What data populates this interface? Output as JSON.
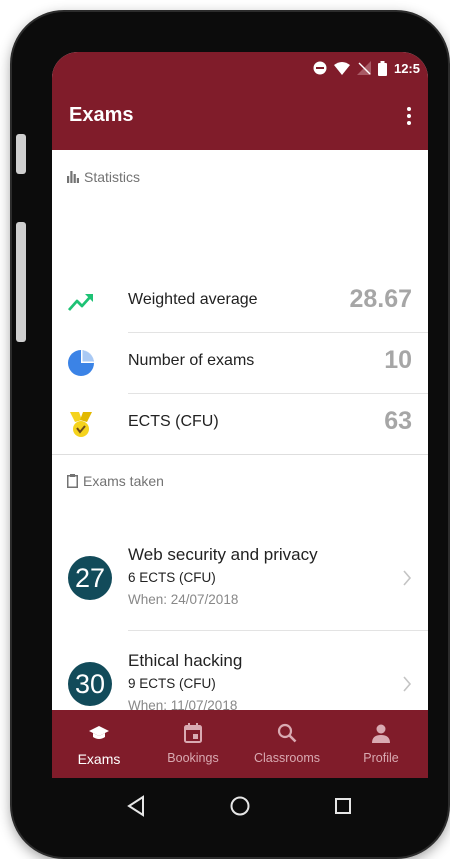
{
  "status_bar": {
    "time": "12:5"
  },
  "app_bar": {
    "title": "Exams"
  },
  "statistics": {
    "header": "Statistics",
    "items": [
      {
        "label": "Weighted average",
        "value": "28.67",
        "icon": "trending-up-icon"
      },
      {
        "label": "Number of exams",
        "value": "10",
        "icon": "pie-chart-icon"
      },
      {
        "label": "ECTS (CFU)",
        "value": "63",
        "icon": "medal-icon"
      }
    ]
  },
  "exams_taken": {
    "header": "Exams taken",
    "items": [
      {
        "grade": "27",
        "name": "Web security and privacy",
        "credits": "6 ECTS (CFU)",
        "when": "When: 24/07/2018"
      },
      {
        "grade": "30",
        "name": "Ethical hacking",
        "credits": "9 ECTS (CFU)",
        "when": "When: 11/07/2018"
      }
    ]
  },
  "bottom_nav": [
    {
      "label": "Exams",
      "icon": "graduation-cap-icon",
      "active": true
    },
    {
      "label": "Bookings",
      "icon": "calendar-icon",
      "active": false
    },
    {
      "label": "Classrooms",
      "icon": "search-icon",
      "active": false
    },
    {
      "label": "Profile",
      "icon": "person-icon",
      "active": false
    }
  ],
  "colors": {
    "primary": "#801c2a",
    "grade_badge": "#124b5a",
    "trend_green": "#1ec275",
    "pie_blue": "#3b83e6",
    "medal_yellow": "#f5d31d"
  }
}
